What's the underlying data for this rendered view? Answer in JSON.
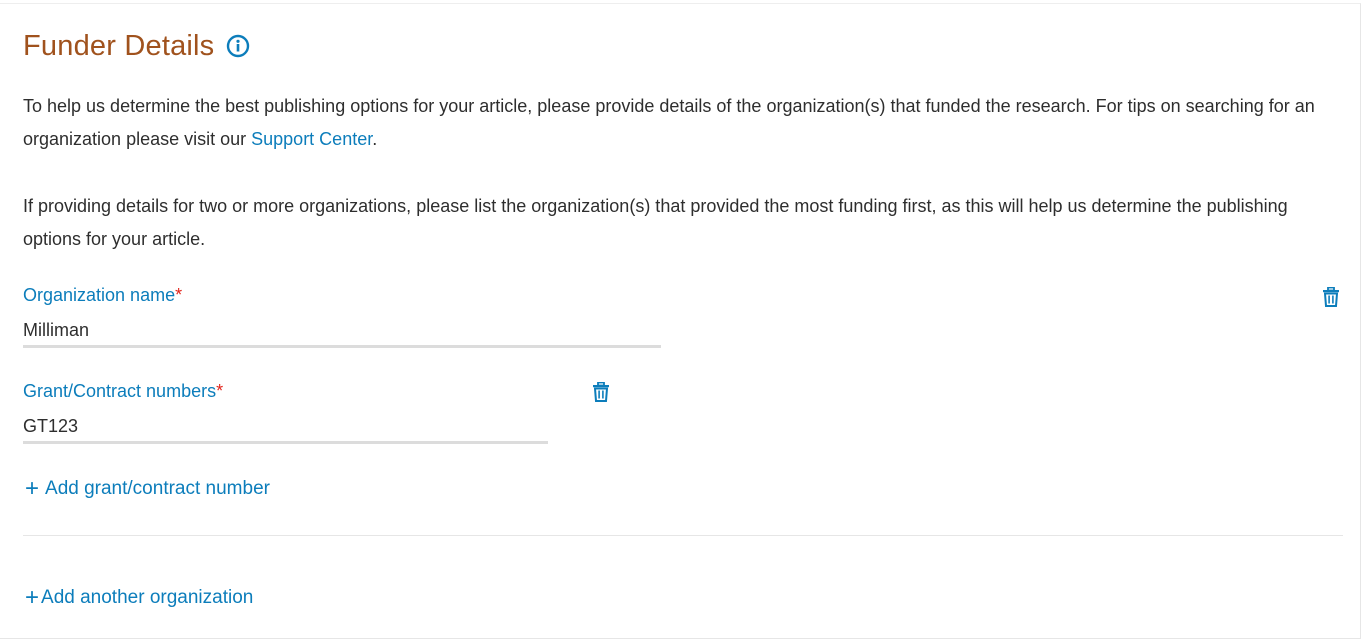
{
  "section": {
    "title": "Funder Details",
    "info_icon": "info-circle-icon",
    "intro_before_link": "To help us determine the best publishing options for your article, please provide details of the organization(s) that funded the research. For tips on searching for an organization please visit our ",
    "intro_link": "Support Center",
    "intro_after_link": ".",
    "ordering_note": "If providing details for two or more organizations, please list the organization(s) that provided the most funding first, as this will help us determine the publishing options for your article."
  },
  "organization": {
    "name_label": "Organization name",
    "required_mark": "*",
    "name_value": "Milliman",
    "delete_icon": "trash-icon",
    "grant_label": "Grant/Contract numbers",
    "grant_required_mark": "*",
    "grant_value": "GT123",
    "grant_delete_icon": "trash-icon",
    "add_grant_plus": "+",
    "add_grant_label": "Add grant/contract number"
  },
  "add_org": {
    "plus": "+",
    "label": "Add another organization"
  },
  "colors": {
    "title": "#a0521d",
    "link": "#0c7dbb",
    "required": "#e2231a",
    "text": "#2e2e2e"
  }
}
